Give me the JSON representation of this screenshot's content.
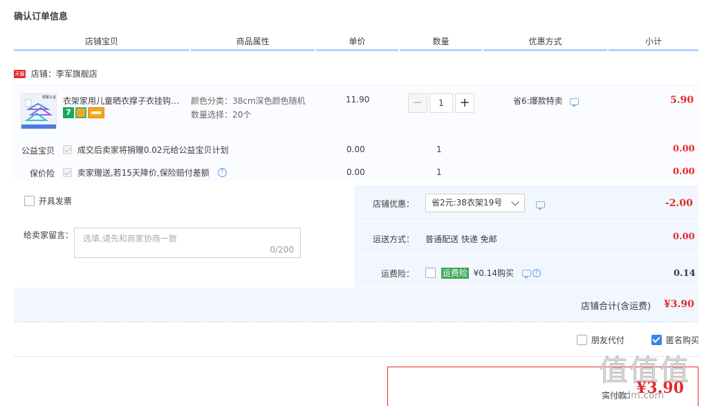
{
  "page_title": "确认订单信息",
  "columns": [
    "店铺宝贝",
    "商品属性",
    "单价",
    "数量",
    "优惠方式",
    "小计"
  ],
  "shop": {
    "badge": "天猫",
    "label": "店铺：李军旗舰店"
  },
  "item": {
    "thumb_text": "顾客认证",
    "title": "衣架家用儿童晒衣撑子衣挂钩晾衣架",
    "badge_7": "7",
    "attr_color": "颜色分类：38cm深色颜色随机",
    "attr_qty": "数量选择：20个",
    "unit_price": "11.90",
    "qty_minus": "−",
    "qty_value": "1",
    "qty_plus": "+",
    "promo": "省6:爆款特卖",
    "subtotal": "5.90"
  },
  "charity": {
    "label": "公益宝贝",
    "text": "成交后卖家将捐赠0.02元给公益宝贝计划",
    "price": "0.00",
    "qty": "1",
    "subtotal": "0.00"
  },
  "insurance": {
    "label": "保价险",
    "text": "卖家赠送,若15天降价,保险赔付差额",
    "help": "?",
    "price": "0.00",
    "qty": "1",
    "subtotal": "0.00"
  },
  "invoice": {
    "label": "开具发票"
  },
  "message": {
    "label": "给卖家留言：",
    "placeholder": "选填,请先和商家协商一致",
    "count": "0/200"
  },
  "shop_discount": {
    "label": "店铺优惠：",
    "selected": "省2元:38衣架19号",
    "amount": "-2.00"
  },
  "shipping": {
    "label": "运送方式：",
    "value": "普通配送 快递 免邮",
    "amount": "0.00"
  },
  "freight_insurance": {
    "label": "运费险：",
    "tag": "运费险",
    "text": "¥0.14购买",
    "amount": "0.14"
  },
  "shop_total": {
    "label": "店铺合计(含运费)",
    "amount": "¥3.90"
  },
  "options": {
    "friend_pay": "朋友代付",
    "anonymous": "匿名购买"
  },
  "payment": {
    "label": "实付款：",
    "amount": "¥3.90"
  },
  "watermark": {
    "main": "值值值",
    "sub": "smzdm.com"
  },
  "colors": {
    "accent_red": "#e4292b",
    "header_line": "#b2d1ff",
    "panel_bg": "#f2f7ff",
    "check_blue": "#3a86e8",
    "insurance_green": "#3aa655"
  }
}
